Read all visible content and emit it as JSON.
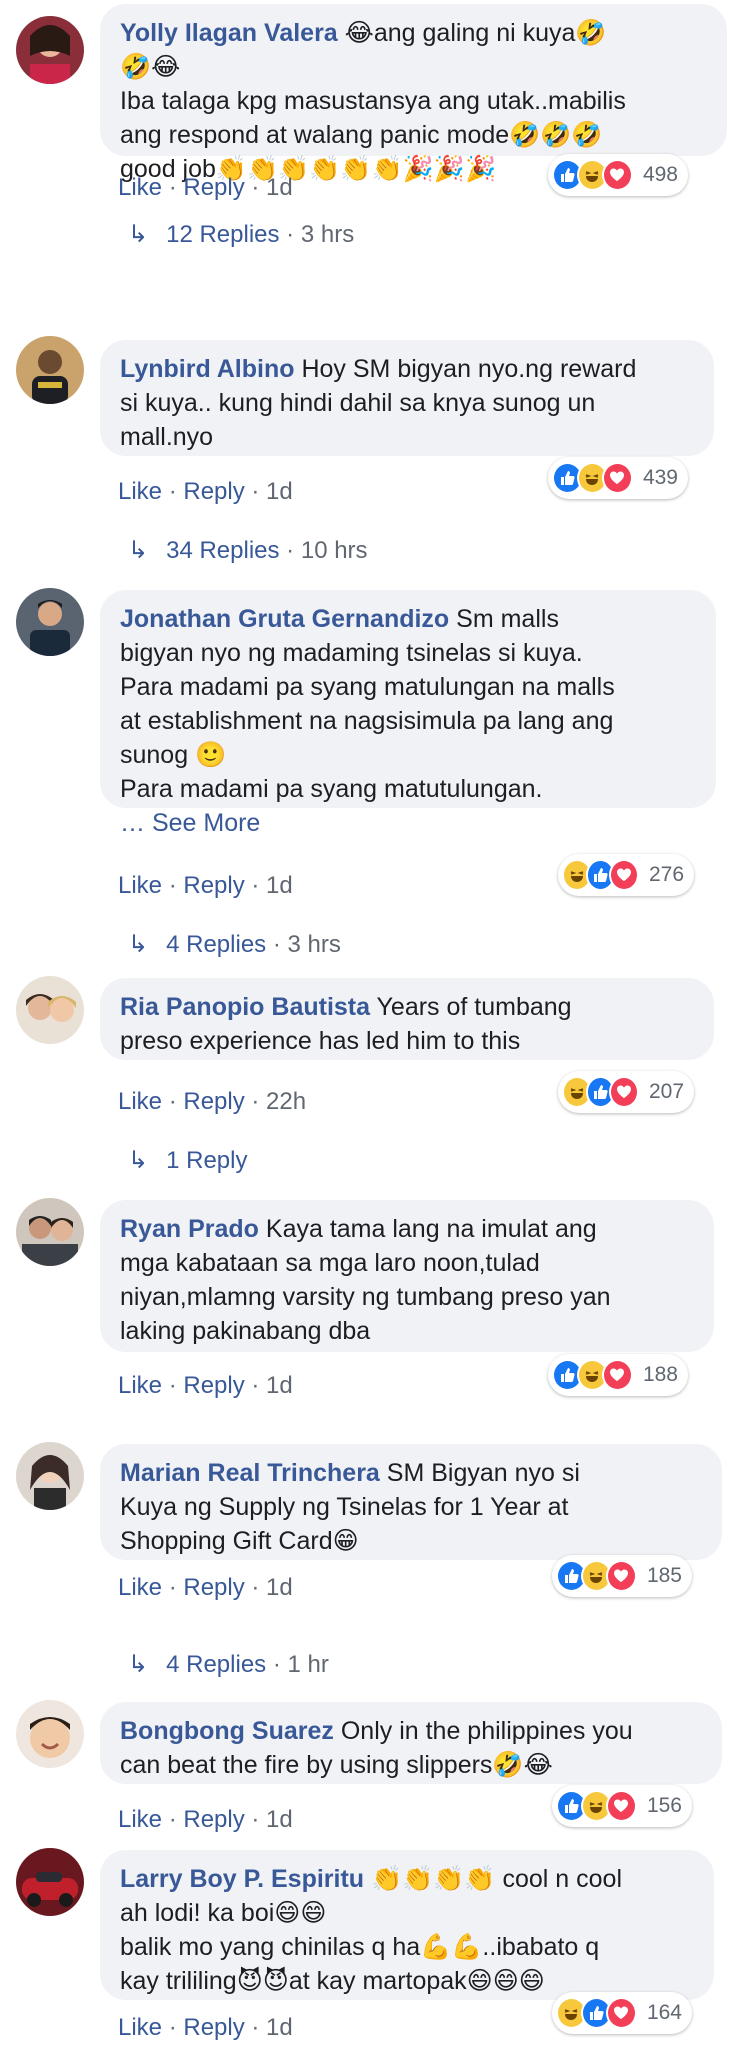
{
  "actions": {
    "like": "Like",
    "reply": "Reply",
    "dot": " · "
  },
  "comments": [
    {
      "author": "Yolly Ilagan Valera",
      "lines": [
        "😂ang galing ni kuya🤣",
        "🤣😂",
        "Iba talaga kpg masustansya ang utak..mabilis",
        "ang respond at walang panic mode🤣🤣🤣",
        "good job👏👏👏👏👏👏🎉🎉🎉"
      ],
      "time": "1d",
      "reactions": [
        "like",
        "haha",
        "love"
      ],
      "count": "498",
      "replies": "12 Replies",
      "replies_time": "3 hrs"
    },
    {
      "author": "Lynbird Albino",
      "lines": [
        "Hoy SM bigyan nyo.ng reward",
        "si kuya.. kung hindi dahil sa knya sunog un",
        "mall.nyo"
      ],
      "time": "1d",
      "reactions": [
        "like",
        "haha",
        "love"
      ],
      "count": "439",
      "replies": "34 Replies",
      "replies_time": "10 hrs"
    },
    {
      "author": "Jonathan Gruta Gernandizo",
      "lines": [
        "Sm malls",
        "bigyan nyo ng madaming tsinelas si kuya.",
        "Para madami pa syang matulungan na malls",
        "at establishment na nagsisimula pa lang ang",
        "sunog 🙂",
        "Para madami pa syang matutulungan."
      ],
      "see_more": "… See More",
      "time": "1d",
      "reactions": [
        "haha",
        "like",
        "love"
      ],
      "count": "276",
      "replies": "4 Replies",
      "replies_time": "3 hrs"
    },
    {
      "author": "Ria Panopio Bautista",
      "lines": [
        "Years of tumbang",
        "preso experience has led him to this"
      ],
      "time": "22h",
      "reactions": [
        "haha",
        "like",
        "love"
      ],
      "count": "207",
      "replies": "1 Reply",
      "replies_time": ""
    },
    {
      "author": "Ryan Prado",
      "lines": [
        "Kaya tama lang na imulat ang",
        "mga kabataan sa mga laro noon,tulad",
        "niyan,mlamng varsity ng tumbang preso yan",
        "laking pakinabang dba"
      ],
      "time": "1d",
      "reactions": [
        "like",
        "haha",
        "love"
      ],
      "count": "188",
      "replies": "",
      "replies_time": ""
    },
    {
      "author": "Marian Real Trinchera",
      "lines": [
        "SM Bigyan nyo si",
        "Kuya ng Supply ng Tsinelas for 1 Year at",
        "Shopping Gift Card😁"
      ],
      "time": "1d",
      "reactions": [
        "like",
        "haha",
        "love"
      ],
      "count": "185",
      "replies": "4 Replies",
      "replies_time": "1 hr"
    },
    {
      "author": "Bongbong Suarez",
      "lines": [
        "Only in the philippines you",
        "can beat the fire by using slippers🤣😂"
      ],
      "time": "1d",
      "reactions": [
        "like",
        "haha",
        "love"
      ],
      "count": "156",
      "replies": "",
      "replies_time": ""
    },
    {
      "author": "Larry Boy P. Espiritu",
      "lines": [
        "👏👏👏👏 cool n cool",
        "ah lodi! ka boi😄😄",
        "balik mo yang chinilas q ha💪💪..ibabato q",
        "kay trililing😈😈at kay martopak😄😄😄"
      ],
      "time": "1d",
      "reactions": [
        "haha",
        "like",
        "love"
      ],
      "count": "164",
      "replies": "",
      "replies_time": ""
    }
  ]
}
